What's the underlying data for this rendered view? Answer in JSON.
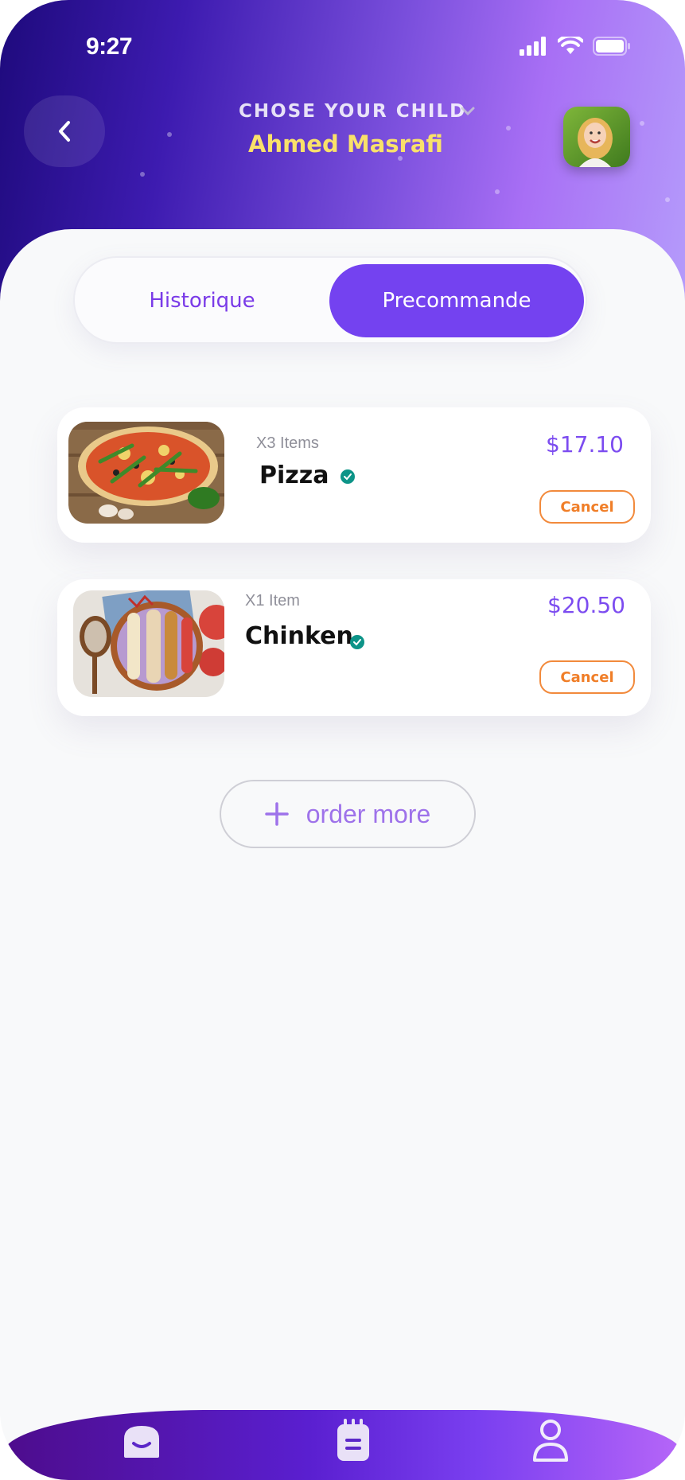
{
  "status_bar": {
    "time": "9:27"
  },
  "header": {
    "choose_label": "CHOSE YOUR CHILD",
    "child_name": "Ahmed Masrafi"
  },
  "tabs": [
    {
      "label": "Historique",
      "active": false
    },
    {
      "label": "Precommande",
      "active": true
    }
  ],
  "orders": [
    {
      "quantity": "X3 Items",
      "name": "Pizza",
      "price": "$17.10",
      "cancel_label": "Cancel",
      "image": "pizza"
    },
    {
      "quantity": "X1 Item",
      "name": "Chinken",
      "price": "$20.50",
      "cancel_label": "Cancel",
      "image": "acai-bowl"
    }
  ],
  "order_more_label": "order more",
  "bottom_nav": [
    {
      "icon": "home-icon"
    },
    {
      "icon": "notepad-icon"
    },
    {
      "icon": "profile-icon"
    }
  ],
  "colors": {
    "accent": "#7442f0",
    "name_highlight": "#f9e16a",
    "cancel": "#f07e28",
    "verified": "#0d9488"
  }
}
